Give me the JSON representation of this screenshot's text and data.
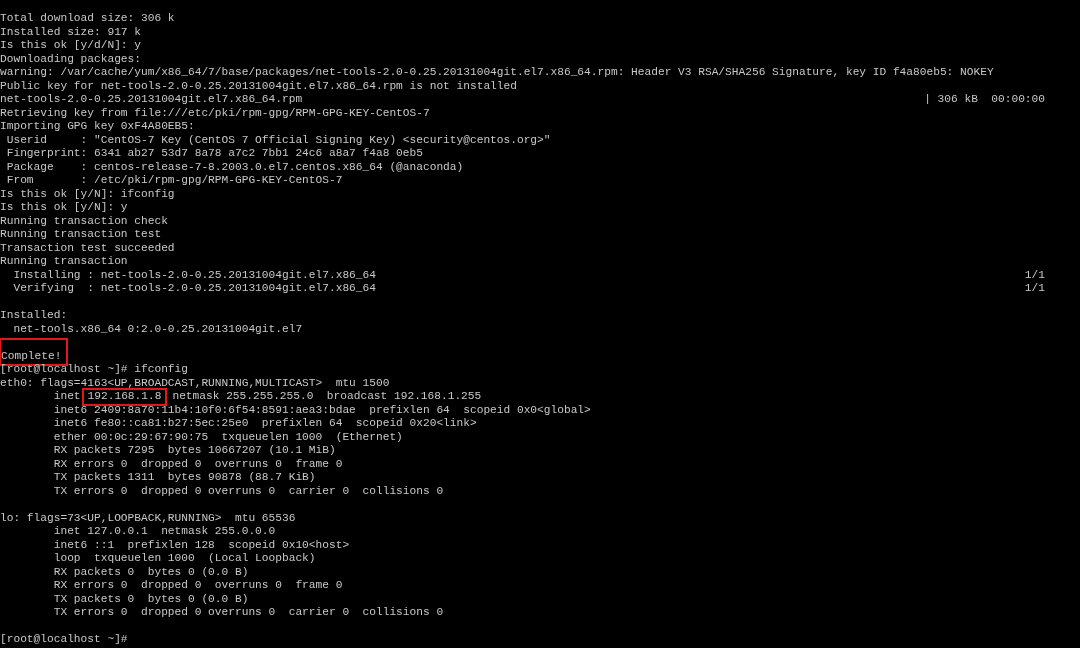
{
  "terminal": {
    "blocks": [
      {
        "lines": [
          {
            "text": "Total download size: 306 k",
            "highlighted": false
          },
          {
            "text": "Installed size: 917 k",
            "highlighted": false
          },
          {
            "text": "Is this ok [y/d/N]: y",
            "highlighted": false
          },
          {
            "text": "Downloading packages:",
            "highlighted": false
          },
          {
            "text": "warning: /var/cache/yum/x86_64/7/base/packages/net-tools-2.0-0.25.20131004git.el7.x86_64.rpm: Header V3 RSA/SHA256 Signature, key ID f4a80eb5: NOKEY",
            "highlighted": false
          },
          {
            "text": "Public key for net-tools-2.0-0.25.20131004git.el7.x86_64.rpm is not installed",
            "highlighted": false
          },
          {
            "text": "net-tools-2.0-0.25.20131004git.el7.x86_64.rpm",
            "right": "| 306 kB  00:00:00",
            "highlighted": false
          },
          {
            "text": "Retrieving key from file:///etc/pki/rpm-gpg/RPM-GPG-KEY-CentOS-7",
            "highlighted": false
          },
          {
            "text": "Importing GPG key 0xF4A80EB5:",
            "highlighted": false
          },
          {
            "text": " Userid     : \"CentOS-7 Key (CentOS 7 Official Signing Key) <security@centos.org>\"",
            "highlighted": false
          },
          {
            "text": " Fingerprint: 6341 ab27 53d7 8a78 a7c2 7bb1 24c6 a8a7 f4a8 0eb5",
            "highlighted": false
          },
          {
            "text": " Package    : centos-release-7-8.2003.0.el7.centos.x86_64 (@anaconda)",
            "highlighted": false
          },
          {
            "text": " From       : /etc/pki/rpm-gpg/RPM-GPG-KEY-CentOS-7",
            "highlighted": false
          },
          {
            "text": "Is this ok [y/N]: ifconfig",
            "highlighted": false
          },
          {
            "text": "Is this ok [y/N]: y",
            "highlighted": false
          },
          {
            "text": "Running transaction check",
            "highlighted": false
          },
          {
            "text": "Running transaction test",
            "highlighted": false
          },
          {
            "text": "Transaction test succeeded",
            "highlighted": false
          },
          {
            "text": "Running transaction",
            "highlighted": false
          },
          {
            "text": "  Installing : net-tools-2.0-0.25.20131004git.el7.x86_64",
            "right": "1/1",
            "highlighted": false
          },
          {
            "text": "  Verifying  : net-tools-2.0-0.25.20131004git.el7.x86_64",
            "right": "1/1",
            "highlighted": false
          }
        ]
      },
      {
        "lines": [
          {
            "text": "Installed:",
            "highlighted": false
          },
          {
            "text": "  net-tools.x86_64 0:2.0-0.25.20131004git.el7",
            "highlighted": false
          }
        ]
      },
      {
        "lines": [
          {
            "text": "Complete!",
            "highlighted": true
          },
          {
            "text": "[root@localhost ~]# ifconfig",
            "highlighted": false
          },
          {
            "text": "eth0: flags=4163<UP,BROADCAST,RUNNING,MULTICAST>  mtu 1500",
            "highlighted": false
          },
          {
            "parts": [
              {
                "text": "        inet",
                "highlighted": false
              },
              {
                "text": "192.168.1.8",
                "highlighted": true
              },
              {
                "text": "netmask 255.255.255.0  broadcast 192.168.1.255",
                "highlighted": false
              }
            ]
          },
          {
            "text": "        inet6 2409:8a70:11b4:10f0:6f54:8591:aea3:bdae  prefixlen 64  scopeid 0x0<global>",
            "highlighted": false
          },
          {
            "text": "        inet6 fe80::ca81:b27:5ec:25e0  prefixlen 64  scopeid 0x20<link>",
            "highlighted": false
          },
          {
            "text": "        ether 00:0c:29:67:90:75  txqueuelen 1000  (Ethernet)",
            "highlighted": false
          },
          {
            "text": "        RX packets 7295  bytes 10667207 (10.1 MiB)",
            "highlighted": false
          },
          {
            "text": "        RX errors 0  dropped 0  overruns 0  frame 0",
            "highlighted": false
          },
          {
            "text": "        TX packets 1311  bytes 90878 (88.7 KiB)",
            "highlighted": false
          },
          {
            "text": "        TX errors 0  dropped 0 overruns 0  carrier 0  collisions 0",
            "highlighted": false
          }
        ]
      },
      {
        "lines": [
          {
            "text": "lo: flags=73<UP,LOOPBACK,RUNNING>  mtu 65536",
            "highlighted": false
          },
          {
            "text": "        inet 127.0.0.1  netmask 255.0.0.0",
            "highlighted": false
          },
          {
            "text": "        inet6 ::1  prefixlen 128  scopeid 0x10<host>",
            "highlighted": false
          },
          {
            "text": "        loop  txqueuelen 1000  (Local Loopback)",
            "highlighted": false
          },
          {
            "text": "        RX packets 0  bytes 0 (0.0 B)",
            "highlighted": false
          },
          {
            "text": "        RX errors 0  dropped 0  overruns 0  frame 0",
            "highlighted": false
          },
          {
            "text": "        TX packets 0  bytes 0 (0.0 B)",
            "highlighted": false
          },
          {
            "text": "        TX errors 0  dropped 0 overruns 0  carrier 0  collisions 0",
            "highlighted": false
          }
        ]
      },
      {
        "lines": [
          {
            "text": "[root@localhost ~]#",
            "highlighted": false
          }
        ]
      }
    ]
  }
}
